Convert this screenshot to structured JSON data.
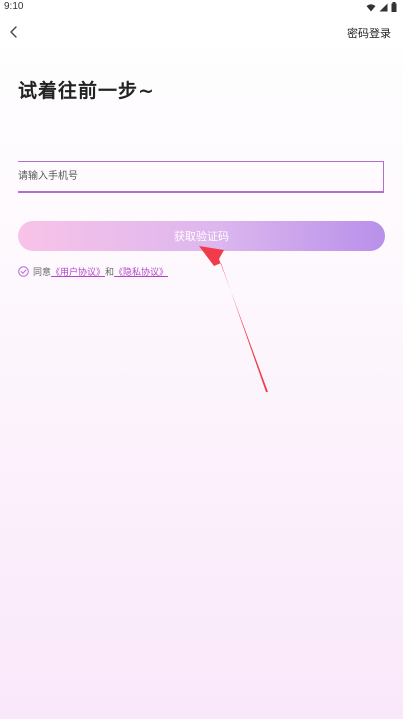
{
  "status_bar": {
    "time": "9:10"
  },
  "nav": {
    "password_login": "密码登录"
  },
  "page": {
    "title": "试着往前一步~"
  },
  "phone_input": {
    "placeholder": "请输入手机号",
    "value": ""
  },
  "get_code_button": {
    "label": "获取验证码"
  },
  "agreement": {
    "prefix": "同意",
    "user_agreement": "《用户协议》",
    "conjunction": "和",
    "privacy_policy": "《隐私协议》"
  },
  "colors": {
    "accent": "#b06fd1",
    "link": "#b046c6",
    "annotation_arrow": "#ef3b4a",
    "button_gradient": [
      "#f8c3e8",
      "#dcb6ee",
      "#b890ea"
    ]
  },
  "icons": {
    "back": "chevron-left-icon",
    "wifi": "wifi-icon",
    "signal": "signal-icon",
    "battery": "battery-icon",
    "agree_check": "check-circle-icon"
  }
}
